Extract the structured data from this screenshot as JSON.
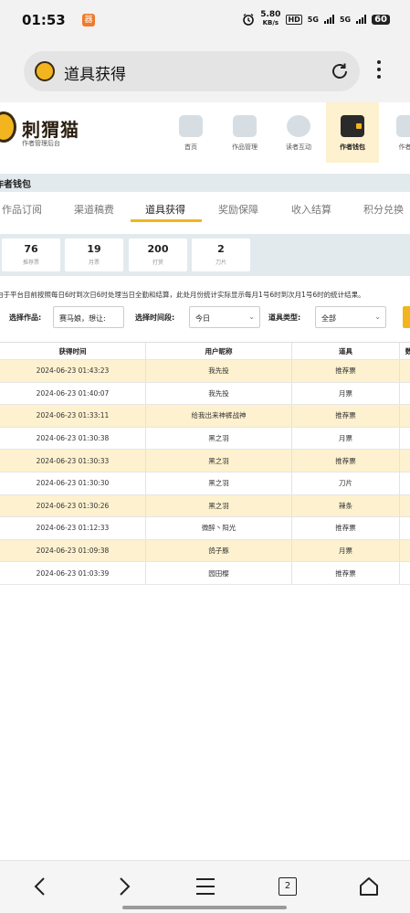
{
  "status_bar": {
    "time": "01:53",
    "app_badge": "器",
    "speed_value": "5.80",
    "speed_unit": "KB/s",
    "hd_label": "HD",
    "net1": "5G",
    "net2": "5G",
    "battery": "60"
  },
  "browser": {
    "page_title": "道具获得"
  },
  "site": {
    "brand_name": "刺猬猫",
    "brand_sub": "作者管理后台",
    "nav": [
      {
        "label": "首页"
      },
      {
        "label": "作品管理"
      },
      {
        "label": "读者互动"
      },
      {
        "label": "作者钱包"
      },
      {
        "label": "作者福"
      }
    ]
  },
  "section_title": "作者钱包",
  "subtabs": [
    {
      "label": "作品订阅"
    },
    {
      "label": "渠道稿费"
    },
    {
      "label": "道具获得"
    },
    {
      "label": "奖励保障"
    },
    {
      "label": "收入结算"
    },
    {
      "label": "积分兑换"
    }
  ],
  "stats": [
    {
      "value": "76",
      "label": "推荐票"
    },
    {
      "value": "19",
      "label": "月票"
    },
    {
      "value": "200",
      "label": "打赏"
    },
    {
      "value": "2",
      "label": "刀片"
    }
  ],
  "notice": "由于平台目前按照每日6时到次日6时处理当日全勤和结算，此处月份统计实际显示每月1号6时到次月1号6时的统计结果。",
  "filters": {
    "work_label": "选择作品:",
    "work_value": "赛马娘，想让:",
    "period_label": "选择时间段:",
    "period_value": "今日",
    "type_label": "道具类型:",
    "type_value": "全部"
  },
  "table": {
    "headers": [
      "获得时间",
      "用户昵称",
      "道具",
      "数"
    ],
    "rows": [
      {
        "time": "2024-06-23 01:43:23",
        "user": "我先投",
        "item": "推荐票"
      },
      {
        "time": "2024-06-23 01:40:07",
        "user": "我先投",
        "item": "月票"
      },
      {
        "time": "2024-06-23 01:33:11",
        "user": "给我出来神裤战神",
        "item": "推荐票"
      },
      {
        "time": "2024-06-23 01:30:38",
        "user": "黑之羽",
        "item": "月票"
      },
      {
        "time": "2024-06-23 01:30:33",
        "user": "黑之羽",
        "item": "推荐票"
      },
      {
        "time": "2024-06-23 01:30:30",
        "user": "黑之羽",
        "item": "刀片"
      },
      {
        "time": "2024-06-23 01:30:26",
        "user": "黑之羽",
        "item": "辣条"
      },
      {
        "time": "2024-06-23 01:12:33",
        "user": "微醉丶阳光",
        "item": "推荐票"
      },
      {
        "time": "2024-06-23 01:09:38",
        "user": "鸽子豚",
        "item": "月票"
      },
      {
        "time": "2024-06-23 01:03:39",
        "user": "园田樱",
        "item": "推荐票"
      }
    ]
  },
  "bottom_nav": {
    "tab_count": "2"
  },
  "colors": {
    "accent": "#f2b51f",
    "highlight_row": "#fdf1cf",
    "band": "#e3eaee"
  }
}
